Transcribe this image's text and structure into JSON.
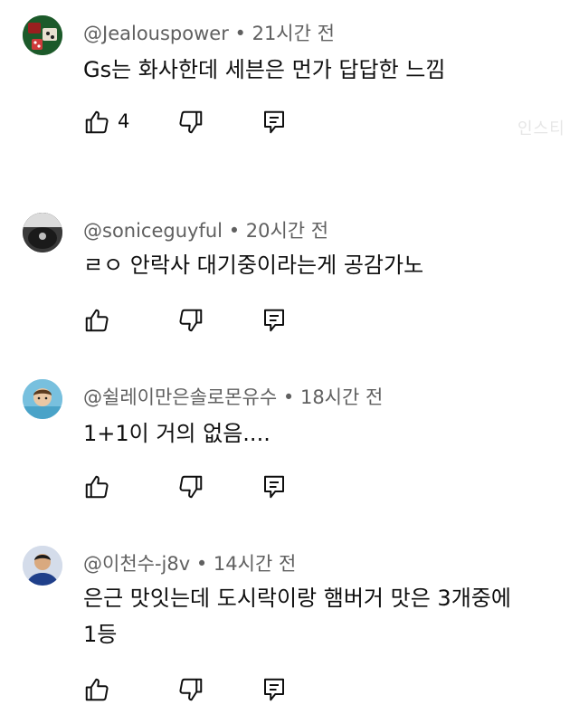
{
  "comments": [
    {
      "author": "@Jealouspower",
      "time": "21시간 전",
      "lines": [
        "Gs는 화사한데 세븐은 먼가 답답한 느낌"
      ],
      "likes": "4"
    },
    {
      "author": "@soniceguyful",
      "time": "20시간 전",
      "lines": [
        "ㄹㅇ 안락사 대기중이라는게 공감가노"
      ],
      "likes": ""
    },
    {
      "author": "@쉴레이만은솔로몬유수",
      "time": "18시간 전",
      "lines": [
        "1+1이 거의 없음...."
      ],
      "likes": ""
    },
    {
      "author": "@이천수-j8v",
      "time": "14시간 전",
      "lines": [
        "은근 맛잇는데 도시락이랑 햄버거 맛은 3개중에",
        "1등"
      ],
      "likes": ""
    }
  ],
  "separator": " • ",
  "watermark": "인스티",
  "icons": {
    "like": "thumbs-up-icon",
    "dislike": "thumbs-down-icon",
    "reply": "reply-comment-icon"
  }
}
